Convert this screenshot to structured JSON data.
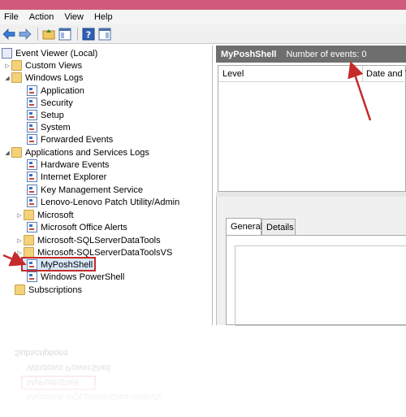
{
  "menu": [
    "File",
    "Action",
    "View",
    "Help"
  ],
  "tree": {
    "root": "Event Viewer (Local)",
    "custom_views": "Custom Views",
    "windows_logs": {
      "label": "Windows Logs",
      "items": [
        "Application",
        "Security",
        "Setup",
        "System",
        "Forwarded Events"
      ]
    },
    "app_services": {
      "label": "Applications and Services Logs",
      "items": [
        "Hardware Events",
        "Internet Explorer",
        "Key Management Service",
        "Lenovo-Lenovo Patch Utility/Admin",
        "Microsoft",
        "Microsoft Office Alerts",
        "Microsoft-SQLServerDataTools",
        "Microsoft-SQLServerDataToolsVS",
        "MyPoshShell",
        "Windows PowerShell"
      ]
    },
    "subscriptions": "Subscriptions"
  },
  "events": {
    "log_name": "MyPoshShell",
    "count_text": "Number of events: 0",
    "columns": [
      "Level",
      "Date and T"
    ]
  },
  "detail": {
    "tabs": [
      "General",
      "Details"
    ]
  },
  "reflection": {
    "items": [
      "Subscriptions",
      "Windows PowerShell",
      "MyPoshShell",
      "Microsoft-SQLServerDataToolsVS"
    ]
  },
  "colors": {
    "titlebar": "#d15a7c",
    "annotation": "#c52a2a",
    "header_bar": "#6e6e6e"
  }
}
